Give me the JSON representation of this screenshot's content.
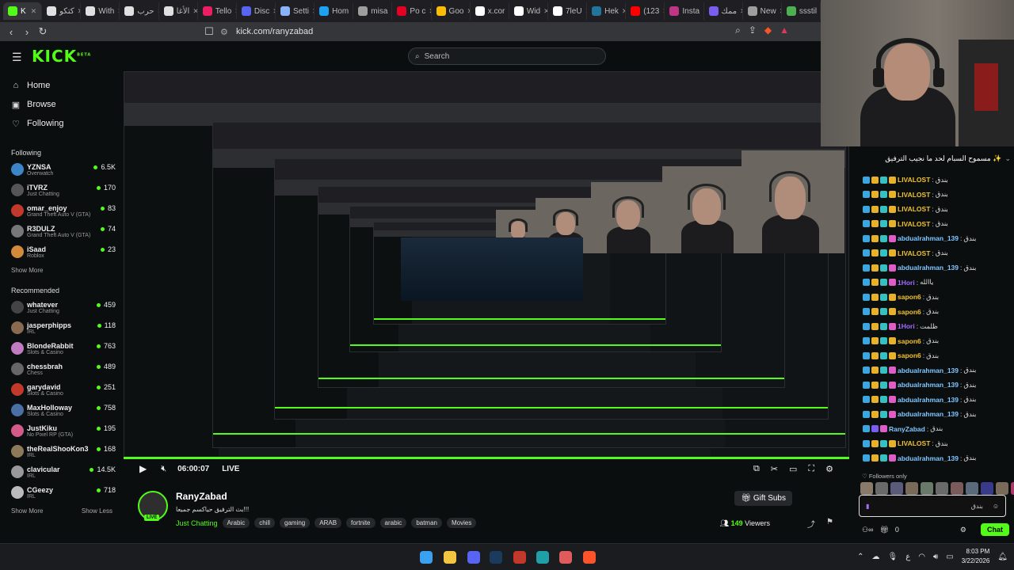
{
  "browser": {
    "tabs": [
      {
        "label": "K",
        "color": "#53fc18",
        "active": true
      },
      {
        "label": "كتكو",
        "color": "#e0e0e0"
      },
      {
        "label": "With",
        "color": "#e0e0e0"
      },
      {
        "label": "حرب",
        "color": "#e0e0e0"
      },
      {
        "label": "الأغا",
        "color": "#e0e0e0"
      },
      {
        "label": "Tello",
        "color": "#e91e63"
      },
      {
        "label": "Disc",
        "color": "#5865f2"
      },
      {
        "label": "Setti",
        "color": "#8ab4f8"
      },
      {
        "label": "Hom",
        "color": "#1da1f2"
      },
      {
        "label": "misa",
        "color": "#9e9e9e"
      },
      {
        "label": "Po c",
        "color": "#e60023"
      },
      {
        "label": "Goo",
        "color": "#fbbc05"
      },
      {
        "label": "x.cor",
        "color": "#ffffff"
      },
      {
        "label": "Wid",
        "color": "#ffffff"
      },
      {
        "label": "7leU",
        "color": "#ffffff"
      },
      {
        "label": "Hek",
        "color": "#21759b"
      },
      {
        "label": "(123",
        "color": "#ff0000"
      },
      {
        "label": "Insta",
        "color": "#c13584"
      },
      {
        "label": "ممك",
        "color": "#7b5cf0"
      },
      {
        "label": "New",
        "color": "#9e9e9e"
      },
      {
        "label": "ssstil",
        "color": "#4caf50"
      }
    ],
    "url": "kick.com/ranyzabad"
  },
  "header": {
    "logo": "KICK",
    "logo_sup": "BETA",
    "search_placeholder": "Search"
  },
  "sidebar": {
    "nav": [
      {
        "label": "Home",
        "icon": "home-icon"
      },
      {
        "label": "Browse",
        "icon": "compass-icon"
      },
      {
        "label": "Following",
        "icon": "heart-icon"
      }
    ],
    "following_title": "Following",
    "following": [
      {
        "name": "YZNSA",
        "sub": "Overwatch",
        "count": "6.5K",
        "color": "#3b86c6"
      },
      {
        "name": "iTVRZ",
        "sub": "Just Chatting",
        "count": "170",
        "color": "#555555"
      },
      {
        "name": "omar_enjoy",
        "sub": "Grand Theft Auto V (GTA)",
        "count": "83",
        "color": "#c0392b"
      },
      {
        "name": "R3DULZ",
        "sub": "Grand Theft Auto V (GTA)",
        "count": "74",
        "color": "#777777"
      },
      {
        "name": "iSaad",
        "sub": "Roblox",
        "count": "23",
        "color": "#d38a3a"
      }
    ],
    "show_more": "Show More",
    "recommended_title": "Recommended",
    "recommended": [
      {
        "name": "whatever",
        "sub": "Just Chatting",
        "count": "459",
        "color": "#444444"
      },
      {
        "name": "jasperphipps",
        "sub": "IRL",
        "count": "118",
        "color": "#8a6a50"
      },
      {
        "name": "BlondeRabbit",
        "sub": "Slots & Casino",
        "count": "763",
        "color": "#c27ac0"
      },
      {
        "name": "chessbrah",
        "sub": "Chess",
        "count": "489",
        "color": "#666666"
      },
      {
        "name": "garydavid",
        "sub": "Slots & Casino",
        "count": "251",
        "color": "#c0392b"
      },
      {
        "name": "MaxHolloway",
        "sub": "Slots & Casino",
        "count": "758",
        "color": "#4a6fa5"
      },
      {
        "name": "JustKiku",
        "sub": "No Pixel RP (GTA)",
        "count": "195",
        "color": "#d35a8a"
      },
      {
        "name": "theRealShooKon3",
        "sub": "IRL",
        "count": "168",
        "color": "#8e7a5a"
      },
      {
        "name": "clavicular",
        "sub": "IRL",
        "count": "14.5K",
        "color": "#999999"
      },
      {
        "name": "CGeezy",
        "sub": "IRL",
        "count": "718",
        "color": "#bbbbbb"
      }
    ],
    "show_more_2": "Show More",
    "show_less": "Show Less"
  },
  "player": {
    "time": "06:00:07",
    "live": "LIVE"
  },
  "stream": {
    "name": "RanyZabad",
    "title": "بث الترفيق حياكسم جميعا!!!",
    "category": "Just Chatting",
    "tags": [
      "Arabic",
      "chill",
      "gaming",
      "ARAB",
      "fortnite",
      "arabic",
      "batman",
      "Movies"
    ],
    "gift_label": "Gift Subs",
    "viewers_count": "149",
    "viewers_label": "Viewers",
    "live_badge": "LIVE"
  },
  "chat": {
    "pinned_text": "مسموح السبام لحد ما نجيب الترفيق ✨",
    "messages": [
      {
        "user": "LIVALOST",
        "text": "بندق",
        "style": "yellow"
      },
      {
        "user": "LIVALOST",
        "text": "بندق",
        "style": "yellow"
      },
      {
        "user": "LIVALOST",
        "text": "بندق",
        "style": "yellow"
      },
      {
        "user": "LIVALOST",
        "text": "بندق",
        "style": "yellow"
      },
      {
        "user": "abdualrahman_139",
        "text": "بندق",
        "style": "blue"
      },
      {
        "user": "LIVALOST",
        "text": "بندق",
        "style": "yellow"
      },
      {
        "user": "abdualrahman_139",
        "text": "بندق",
        "style": "blue"
      },
      {
        "user": "1Hori",
        "text": "ياالله",
        "style": "purple"
      },
      {
        "user": "sapon6",
        "text": "بندق",
        "style": "yellow"
      },
      {
        "user": "sapon6",
        "text": "بندق",
        "style": "yellow"
      },
      {
        "user": "1Hori",
        "text": "ظلمت",
        "style": "purple"
      },
      {
        "user": "sapon6",
        "text": "بندق",
        "style": "yellow"
      },
      {
        "user": "sapon6",
        "text": "بندق",
        "style": "yellow"
      },
      {
        "user": "abdualrahman_139",
        "text": "بندق",
        "style": "blue"
      },
      {
        "user": "abdualrahman_139",
        "text": "بندق",
        "style": "blue"
      },
      {
        "user": "abdualrahman_139",
        "text": "بندق",
        "style": "blue"
      },
      {
        "user": "abdualrahman_139",
        "text": "بندق",
        "style": "blue"
      },
      {
        "user": "RanyZabad",
        "text": "بندق",
        "style": "green"
      },
      {
        "user": "LIVALOST",
        "text": "بندق",
        "style": "yellow"
      },
      {
        "user": "abdualrahman_139",
        "text": "بندق",
        "style": "blue"
      }
    ],
    "followers_only": "Followers only",
    "input_value": "بندق",
    "count": "0",
    "chat_button": "Chat"
  },
  "taskbar": {
    "time": "8:03 PM",
    "date": "3/22/2026",
    "lang": "ع"
  }
}
